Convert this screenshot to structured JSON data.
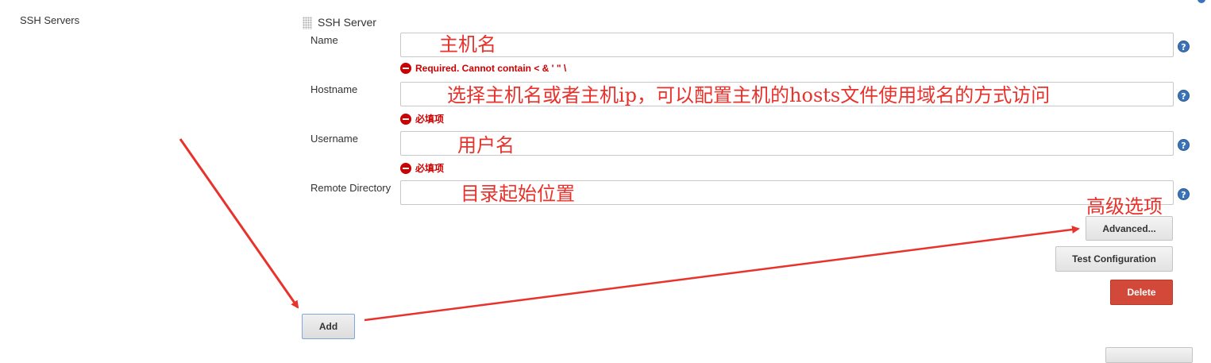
{
  "section": {
    "label": "SSH Servers"
  },
  "group": {
    "title": "SSH Server"
  },
  "fields": [
    {
      "label": "Name",
      "annotation": "主机名",
      "error": "Required. Cannot contain < & ' \" \\"
    },
    {
      "label": "Hostname",
      "annotation": "选择主机名或者主机ip，可以配置主机的hosts文件使用域名的方式访问",
      "error": "必填项"
    },
    {
      "label": "Username",
      "annotation": "用户名",
      "error": "必填项"
    },
    {
      "label": "Remote Directory",
      "annotation": "目录起始位置"
    }
  ],
  "help_glyph": "?",
  "buttons": {
    "advanced": "Advanced...",
    "advanced_annotation": "高级选项",
    "test": "Test Configuration",
    "delete": "Delete",
    "add": "Add"
  },
  "colors": {
    "annotation": "#e8322b",
    "error": "#cc0000",
    "delete": "#d24939",
    "help": "#3b73b9"
  }
}
